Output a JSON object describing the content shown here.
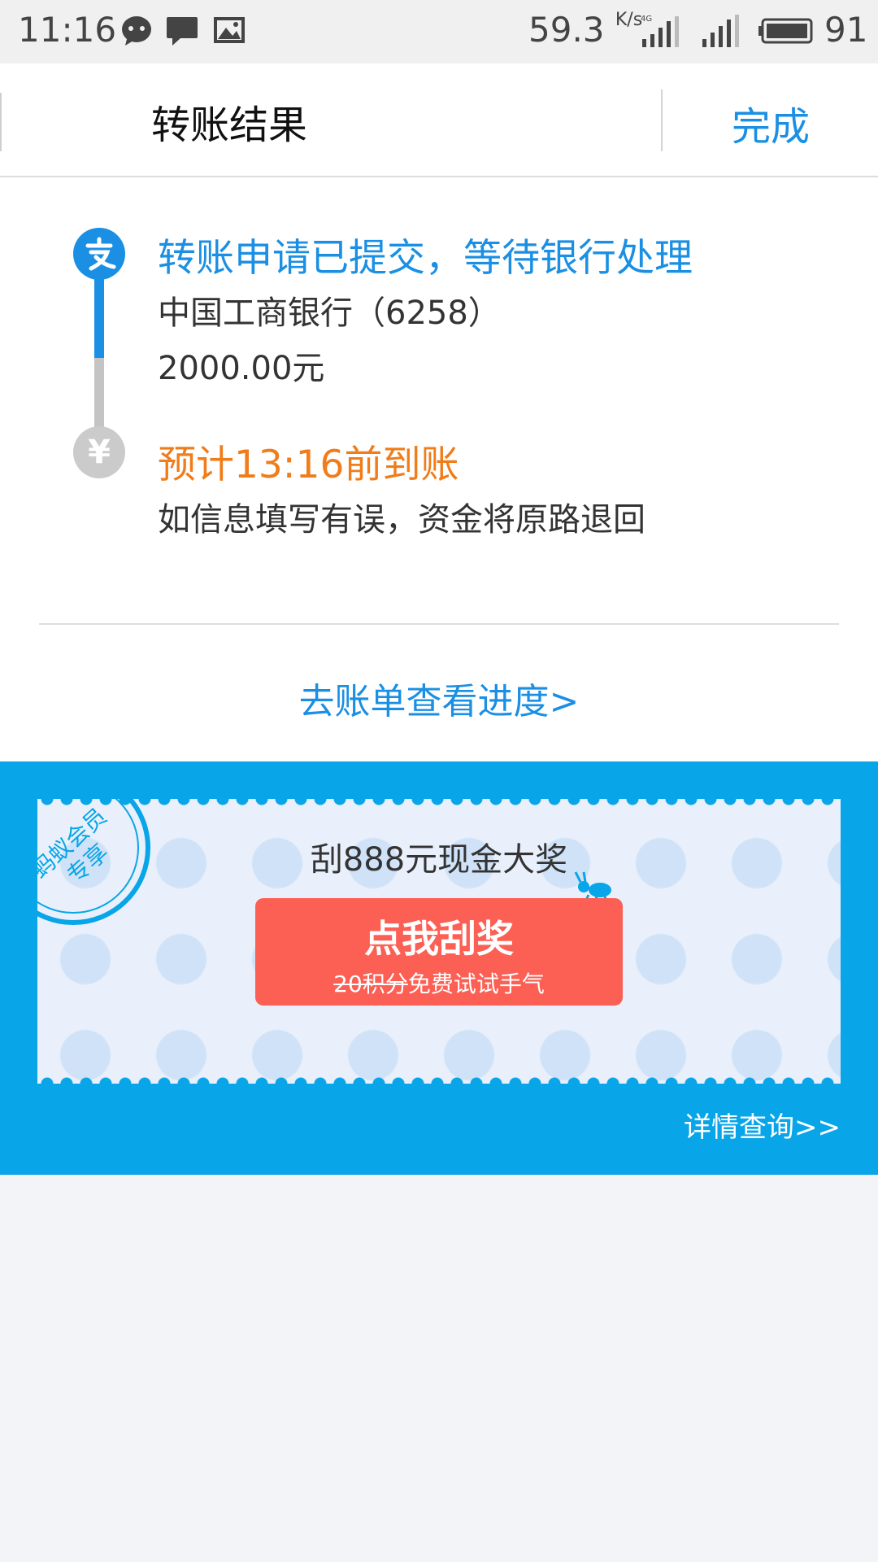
{
  "status_bar": {
    "time": "11:16",
    "speed_value": "59.3",
    "speed_unit": "K/s",
    "network": "4G",
    "battery": "91"
  },
  "header": {
    "title": "转账结果",
    "done_label": "完成"
  },
  "result": {
    "step1_title": "转账申请已提交，等待银行处理",
    "bank": "中国工商银行（6258）",
    "amount": "2000.00元",
    "step2_title": "预计13:16前到账",
    "step2_note": "如信息填写有误，资金将原路退回",
    "bill_link": "去账单查看进度>"
  },
  "promo": {
    "seal_line1": "蚂蚁会员",
    "seal_line2": "专享",
    "title": "刮888元现金大奖",
    "button_main": "点我刮奖",
    "button_strike": "20积分",
    "button_sub": "免费试试手气",
    "details_link": "详情查询>>"
  },
  "colors": {
    "accent": "#1a8fe3",
    "eta": "#f07c1a",
    "promo_bg": "#08a5e8",
    "button": "#fc5f53"
  }
}
